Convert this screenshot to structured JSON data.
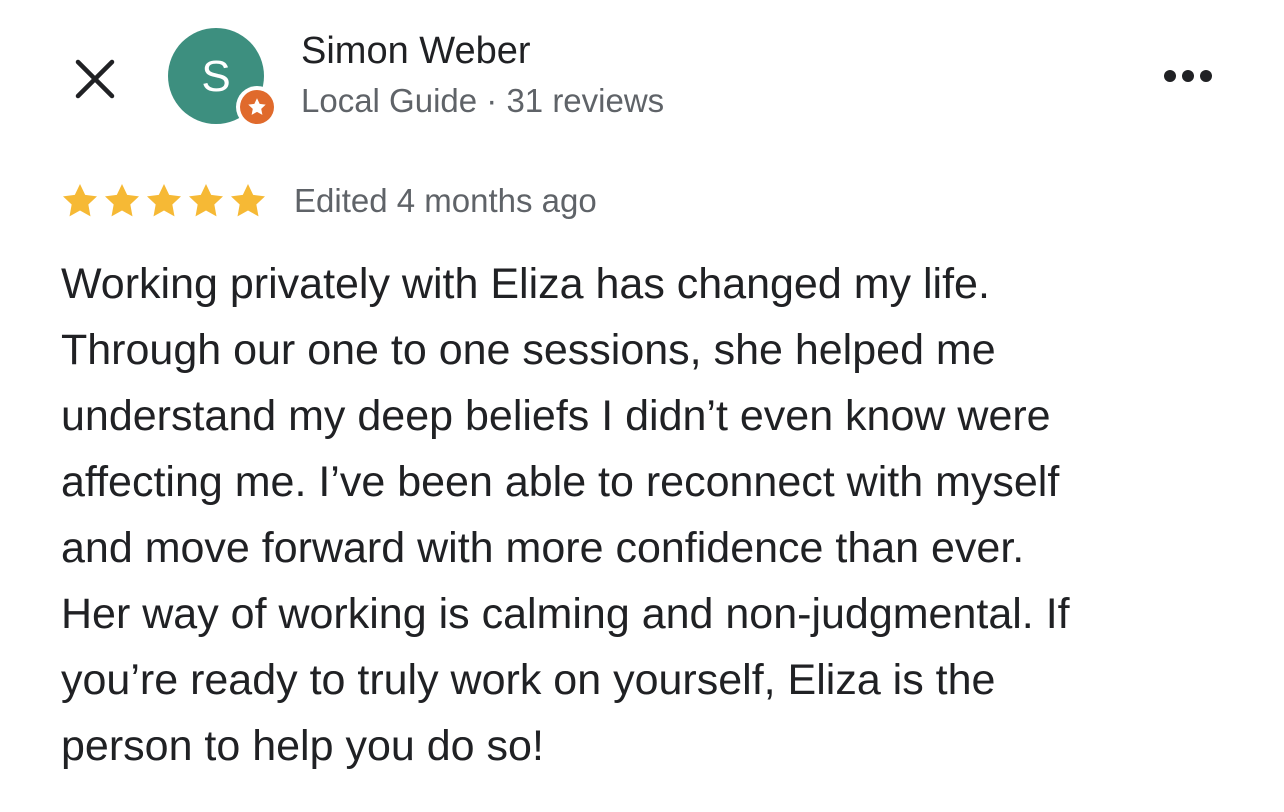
{
  "header": {
    "close_icon": "close-icon",
    "more_icon": "more-horizontal-icon"
  },
  "reviewer": {
    "initial": "S",
    "name": "Simon Weber",
    "meta": "Local Guide · 31 reviews",
    "avatar_color": "#3d8f7f",
    "badge_icon": "local-guide-star-icon",
    "badge_color": "#e06a2c"
  },
  "review": {
    "rating": 5,
    "max_rating": 5,
    "star_color": "#f6b935",
    "edited": "Edited 4 months ago",
    "lines": [
      "Working privately with Eliza has changed my life.",
      "Through our one to one sessions, she helped me",
      "understand my deep beliefs I didn’t even know were",
      "affecting me. I’ve been able to reconnect with myself",
      "and move forward with more confidence than ever.",
      "Her way of working is calming and non-judgmental. If",
      "you’re ready to truly work on yourself, Eliza is the",
      "person to help you do so!"
    ]
  }
}
